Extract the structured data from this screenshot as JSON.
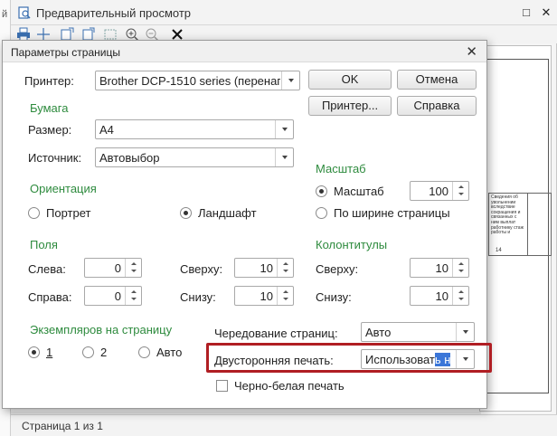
{
  "background": {
    "left_strip_text": "й",
    "window_title": "Предварительный просмотр",
    "status_text": "Страница 1 из 1",
    "stamp_text": "Сведения об увольнении вследствие сокращения и связанных с ним выплат работнику стаж работы и",
    "stamp_number": "14"
  },
  "dialog": {
    "title": "Параметры страницы",
    "printer_label": "Принтер:",
    "printer_value": "Brother DCP-1510 series (перенап",
    "ok_label": "OK",
    "cancel_label": "Отмена",
    "printer_button_label": "Принтер...",
    "help_label": "Справка",
    "paper_section": "Бумага",
    "size_label": "Размер:",
    "size_value": "A4",
    "source_label": "Источник:",
    "source_value": "Автовыбор",
    "scale_section": "Масштаб",
    "scale_radio_label": "Масштаб",
    "scale_value": "100",
    "fit_width_label": "По ширине страницы",
    "orientation_section": "Ориентация",
    "portrait_label": "Портрет",
    "landscape_label": "Ландшафт",
    "margins_section": "Поля",
    "left_label": "Слева:",
    "left_value": "0",
    "right_label": "Справа:",
    "right_value": "0",
    "top_label": "Сверху:",
    "top_value": "10",
    "bottom_label": "Снизу:",
    "bottom_value": "10",
    "headers_section": "Колонтитулы",
    "header_top_label": "Сверху:",
    "header_top_value": "10",
    "header_bottom_label": "Снизу:",
    "header_bottom_value": "10",
    "copies_section": "Экземпляров на страницу",
    "copies_1": "1",
    "copies_2": "2",
    "copies_auto": "Авто",
    "alternation_label": "Чередование страниц:",
    "alternation_value": "Авто",
    "duplex_label": "Двусторонняя печать:",
    "duplex_value_plain": "Использоват",
    "duplex_value_selected": "ь н",
    "bw_label": "Черно-белая печать"
  },
  "colors": {
    "section_green": "#2e8b3e",
    "highlight_red": "#b01e23",
    "selection_blue": "#3b76d8"
  }
}
